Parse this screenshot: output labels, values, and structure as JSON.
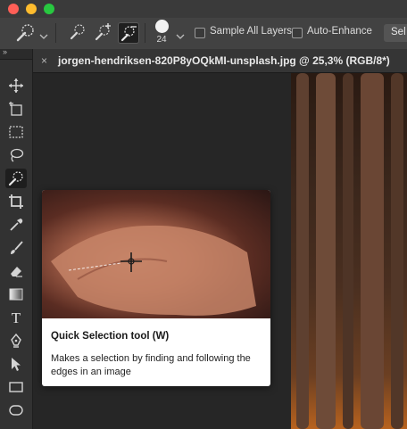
{
  "window": {
    "traffic_lights": [
      "close",
      "minimize",
      "zoom"
    ]
  },
  "options_bar": {
    "brush_size": "24",
    "sample_all_layers": {
      "label": "Sample All Layers",
      "checked": false
    },
    "auto_enhance": {
      "label": "Auto-Enhance",
      "checked": false
    },
    "select_button_label": "Sel"
  },
  "tools_panel": {
    "collapse_glyph": "»",
    "tools": [
      {
        "name": "move-tool",
        "icon": "move-icon"
      },
      {
        "name": "artboard-tool",
        "icon": "artboard-icon"
      },
      {
        "name": "marquee-tool",
        "icon": "rectangular-marquee-icon"
      },
      {
        "name": "lasso-tool",
        "icon": "lasso-icon"
      },
      {
        "name": "quick-selection-tool",
        "icon": "quick-selection-icon",
        "active": true
      },
      {
        "name": "crop-tool",
        "icon": "crop-icon"
      },
      {
        "name": "eyedropper-tool",
        "icon": "eyedropper-icon"
      },
      {
        "name": "brush-tool",
        "icon": "brush-icon"
      },
      {
        "name": "eraser-tool",
        "icon": "eraser-icon"
      },
      {
        "name": "gradient-tool",
        "icon": "gradient-icon"
      },
      {
        "name": "type-tool",
        "icon": "type-icon",
        "glyph": "T"
      },
      {
        "name": "pen-tool",
        "icon": "pen-icon"
      },
      {
        "name": "path-selection-tool",
        "icon": "path-selection-icon"
      },
      {
        "name": "rectangle-tool",
        "icon": "rectangle-icon"
      },
      {
        "name": "ellipse-tool",
        "icon": "ellipse-icon"
      }
    ]
  },
  "document_tab": {
    "close_glyph": "×",
    "title": "jorgen-hendriksen-820P8yOQkMI-unsplash.jpg @ 25,3% (RGB/8*)"
  },
  "tooltip": {
    "title": "Quick Selection tool (W)",
    "description": "Makes a selection by finding and following the edges in an image"
  }
}
